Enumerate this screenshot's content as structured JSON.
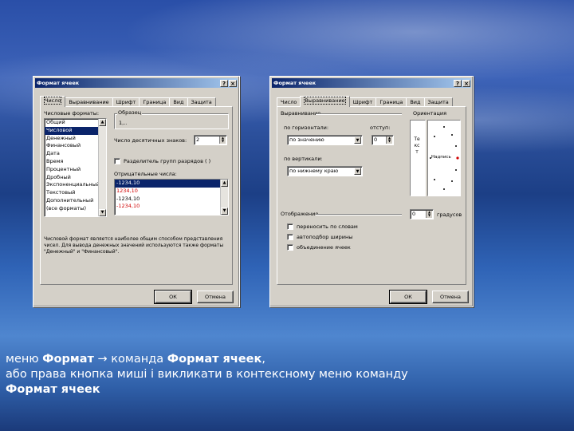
{
  "dialog_left": {
    "title": "Формат ячеек",
    "help_btn": "?",
    "close_btn": "×",
    "tabs": [
      "Число",
      "Выравнивание",
      "Шрифт",
      "Граница",
      "Вид",
      "Защита"
    ],
    "formats_label": "Числовые форматы:",
    "formats": [
      "Общий",
      "Числовой",
      "Денежный",
      "Финансовый",
      "Дата",
      "Время",
      "Процентный",
      "Дробный",
      "Экспоненциальный",
      "Текстовый",
      "Дополнительный",
      "(все форматы)"
    ],
    "sample_group": "Образец",
    "sample_value": "1,..",
    "decimals_label": "Число десятичных знаков:",
    "decimals_value": "2",
    "separator_label": "Разделитель групп разрядов ( )",
    "negative_label": "Отрицательные числа:",
    "negative_items": [
      "-1234,10",
      "1234,10",
      "-1234,10",
      "-1234,10"
    ],
    "description": "Числовой формат является наиболее общим способом представления чисел. Для вывода денежных значений используются также форматы \"Денежный\" и \"Финансовый\".",
    "ok": "ОК",
    "cancel": "Отмена"
  },
  "dialog_right": {
    "title": "Формат ячеек",
    "help_btn": "?",
    "close_btn": "×",
    "tabs": [
      "Число",
      "Выравнивание",
      "Шрифт",
      "Граница",
      "Вид",
      "Защита"
    ],
    "alignment_label": "Выравнивание",
    "horizontal_label": "по горизонтали:",
    "horizontal_value": "по значению",
    "indent_label": "отступ:",
    "indent_value": "0",
    "vertical_label": "по вертикали:",
    "vertical_value": "по нижнему краю",
    "orientation_label": "Ориентация",
    "orientation_vertical_text": "Текст",
    "orientation_horizontal_text": "Надпись",
    "degrees_value": "0",
    "degrees_label": "градусов",
    "display_label": "Отображение",
    "wrap_label": "переносить по словам",
    "autofit_label": "автоподбор ширины",
    "merge_label": "объединение ячеек",
    "ok": "ОК",
    "cancel": "Отмена"
  },
  "caption": {
    "line1_a": "меню ",
    "line1_b": "Формат",
    "line1_c": " → команда ",
    "line1_d": "Формат ячеек",
    "line1_e": ",",
    "line2": "або права кнопка миші і викликати в контексному меню команду",
    "line3": "Формат ячеек"
  }
}
